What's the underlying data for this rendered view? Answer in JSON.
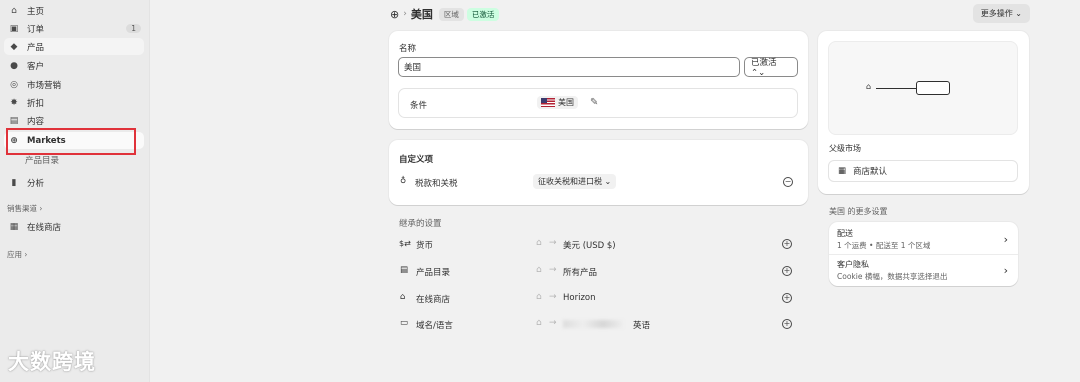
{
  "sidebar": {
    "items": [
      {
        "icon": "home-icon",
        "glyph": "⌂",
        "label": "主页"
      },
      {
        "icon": "inbox-icon",
        "glyph": "▣",
        "label": "订单",
        "badge": "1"
      },
      {
        "icon": "tag-icon",
        "glyph": "◆",
        "label": "产品"
      },
      {
        "icon": "person-icon",
        "glyph": "●",
        "label": "客户"
      },
      {
        "icon": "target-icon",
        "glyph": "◎",
        "label": "市场营销"
      },
      {
        "icon": "discount-icon",
        "glyph": "✸",
        "label": "折扣"
      },
      {
        "icon": "image-icon",
        "glyph": "▤",
        "label": "内容"
      },
      {
        "icon": "globe-icon",
        "glyph": "⊕",
        "label": "Markets"
      }
    ],
    "sub_item": "产品目录",
    "analytics": {
      "icon": "chart-bar-icon",
      "glyph": "▮",
      "label": "分析"
    },
    "sales_channels_label": "销售渠道 ›",
    "online_store": {
      "icon": "store-icon",
      "glyph": "▦",
      "label": "在线商店"
    },
    "apps_label": "应用 ›"
  },
  "watermark": "大数跨境",
  "header": {
    "separator": "›",
    "title": "美国",
    "tag_region": "区域",
    "tag_status": "已激活",
    "more_actions": "更多操作 ⌄"
  },
  "name_card": {
    "name_label": "名称",
    "name_value": "美国",
    "status_select": "已激活 ⌃⌄",
    "conditions_label": "条件",
    "condition_chip": "美国"
  },
  "custom_card": {
    "title": "自定义项",
    "tax_label": "税款和关税",
    "tax_select": "征收关税和进口税 ⌄",
    "minus": "−"
  },
  "inherited": {
    "title": "继承的设置",
    "rows": [
      {
        "icon": "currency-icon",
        "glyph": "$⇄",
        "label": "货币",
        "value": "美元 (USD $)"
      },
      {
        "icon": "catalog-icon",
        "glyph": "▤",
        "label": "产品目录",
        "value": "所有产品"
      },
      {
        "icon": "store-icon",
        "glyph": "⌂",
        "label": "在线商店",
        "value": "Horizon"
      },
      {
        "icon": "domain-icon",
        "glyph": "▭",
        "label": "域名/语言",
        "value": "英语"
      }
    ],
    "plus": "+",
    "arrow": "→"
  },
  "right": {
    "parent_market_label": "父级市场",
    "parent_market_value": "商店默认",
    "more_settings_title": "美国 的更多设置",
    "settings": [
      {
        "title": "配送",
        "desc": "1 个运费 • 配送至 1 个区域"
      },
      {
        "title": "客户隐私",
        "desc": "Cookie 横幅，数据共享选择退出"
      }
    ],
    "chevron": "›"
  }
}
